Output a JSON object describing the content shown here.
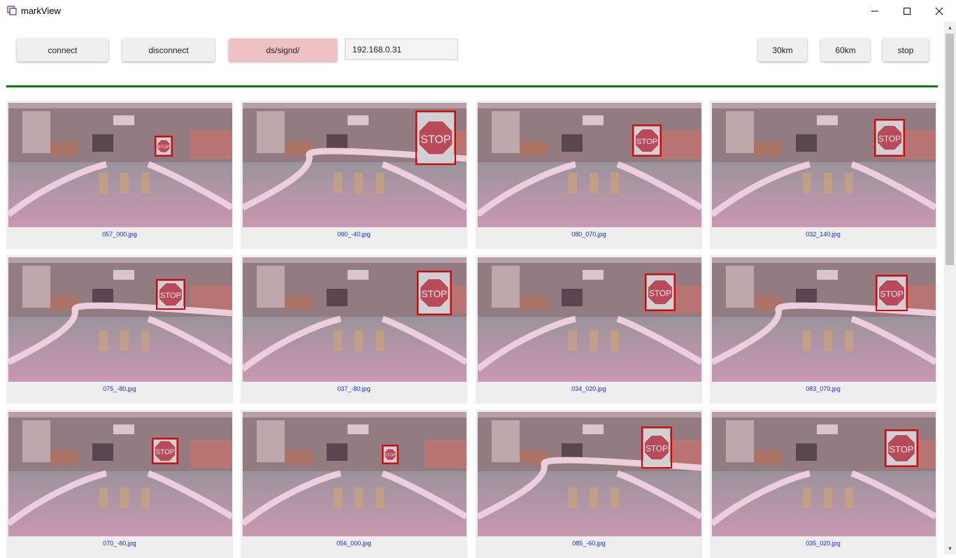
{
  "window": {
    "title": "markView",
    "app_icon": "window-app-icon",
    "minimize_icon": "minimize-icon",
    "maximize_icon": "maximize-icon",
    "close_icon": "close-icon"
  },
  "toolbar": {
    "connect_label": "connect",
    "disconnect_label": "disconnect",
    "dataset_label": "ds/signd/",
    "ip_value": "192.168.0.31",
    "speed30_label": "30km",
    "speed60_label": "60km",
    "stop_label": "stop",
    "dataset_color": "#eec2c4",
    "divider_color": "#0a7a0a"
  },
  "gallery": {
    "caption_color": "#1030d0",
    "items": [
      {
        "filename": "057_000.jpg"
      },
      {
        "filename": "090_-40.jpg"
      },
      {
        "filename": "080_070.jpg"
      },
      {
        "filename": "032_140.jpg"
      },
      {
        "filename": "075_-80.jpg"
      },
      {
        "filename": "037_-80.jpg"
      },
      {
        "filename": "034_020.jpg"
      },
      {
        "filename": "083_070.jpg"
      },
      {
        "filename": "070_-80.jpg"
      },
      {
        "filename": "056_000.jpg"
      },
      {
        "filename": "085_-60.jpg"
      },
      {
        "filename": "035_020.jpg"
      }
    ],
    "sign_text": "STOP"
  },
  "scrollbar": {
    "up_icon": "scroll-up-arrow-icon",
    "down_icon": "scroll-down-arrow-icon"
  }
}
